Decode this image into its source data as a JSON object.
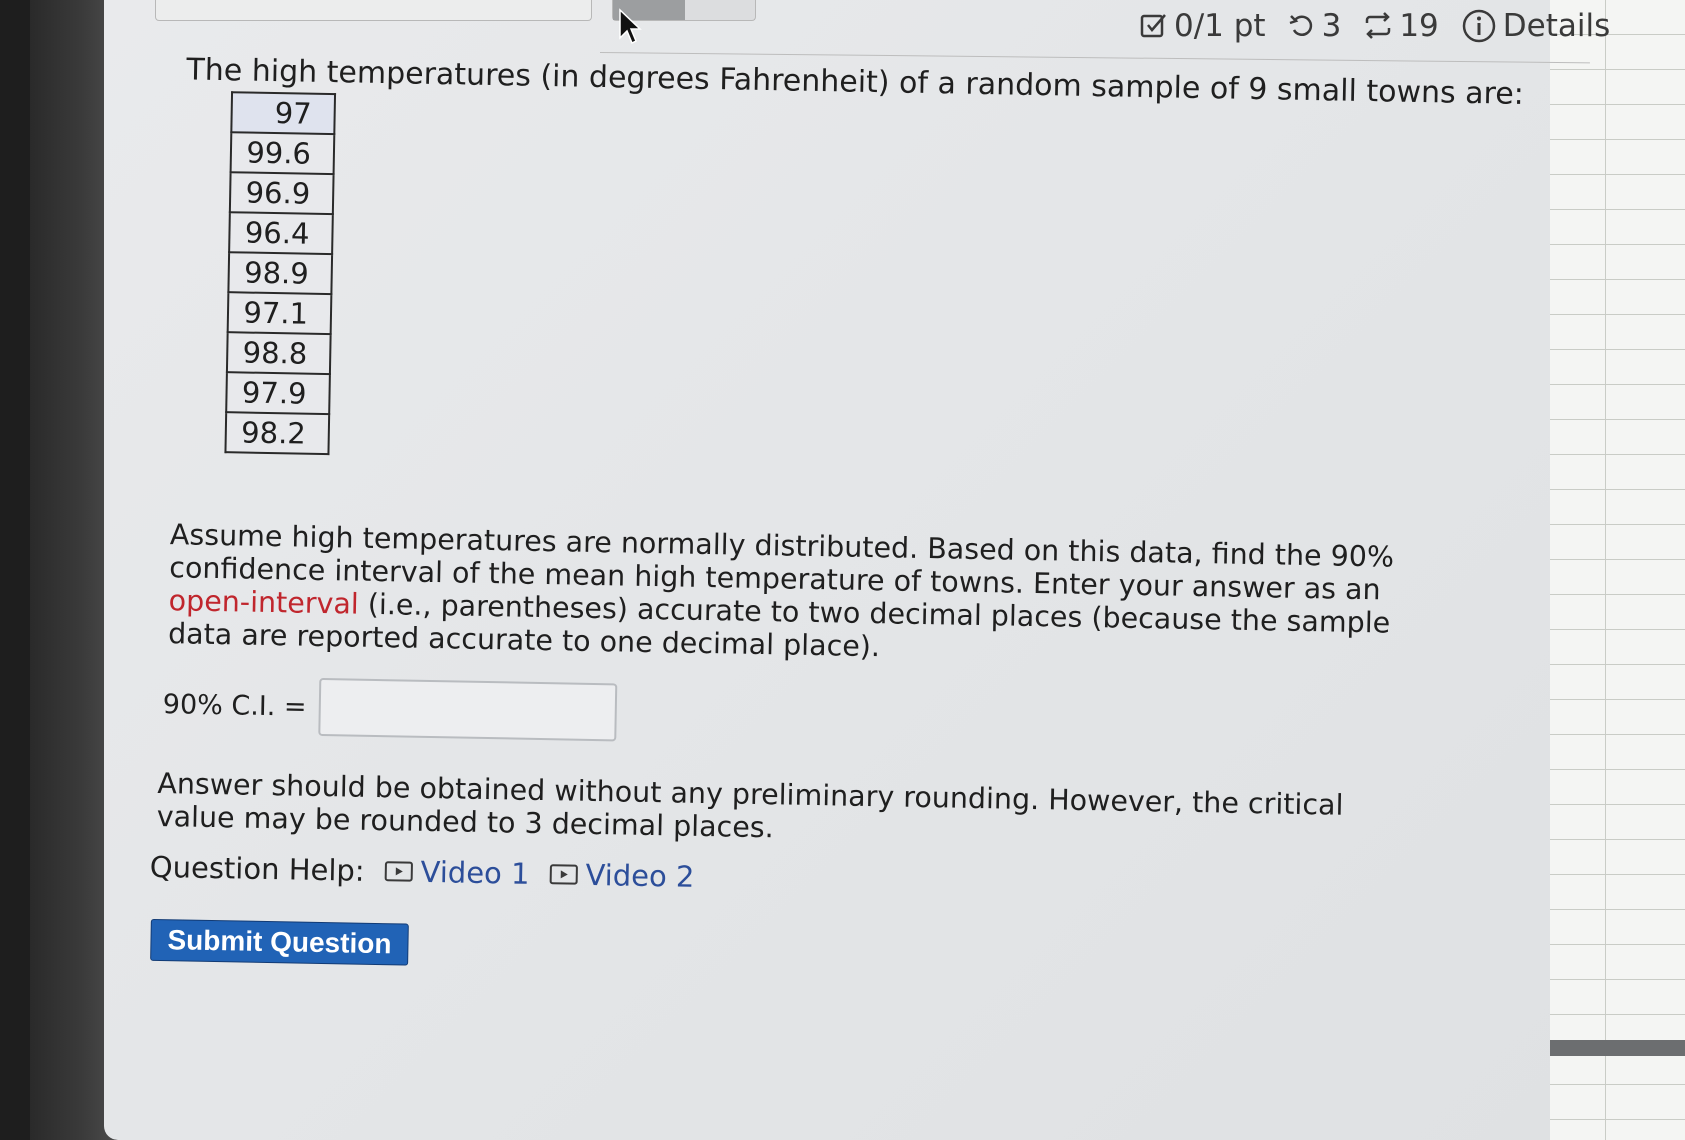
{
  "status": {
    "score": "0/1 pt",
    "retries": "3",
    "attempts": "19",
    "details_label": "Details"
  },
  "question": {
    "intro": "The high temperatures (in degrees Fahrenheit) of a random sample of 9 small towns are:",
    "temperatures": [
      "97",
      "99.6",
      "96.9",
      "96.4",
      "98.9",
      "97.1",
      "98.8",
      "97.9",
      "98.2"
    ],
    "instruction_part1": "Assume high temperatures are normally distributed. Based on this data, find the 90% confidence interval of the mean high temperature of towns. Enter your answer as an ",
    "instruction_link": "open-interval",
    "instruction_part2": " (i.e., parentheses) accurate to two decimal places (because the sample data are reported accurate to one decimal place).",
    "ci_label": "90% C.I. =",
    "ci_value": "",
    "note": "Answer should be obtained without any preliminary rounding. However, the critical value may be rounded to 3 decimal places.",
    "help_label": "Question Help:",
    "video1_label": "Video 1",
    "video2_label": "Video 2",
    "submit_label": "Submit Question"
  },
  "colors": {
    "submit_bg": "#2163b6",
    "link_red": "#c0262d",
    "video_link": "#2c4e9a"
  }
}
